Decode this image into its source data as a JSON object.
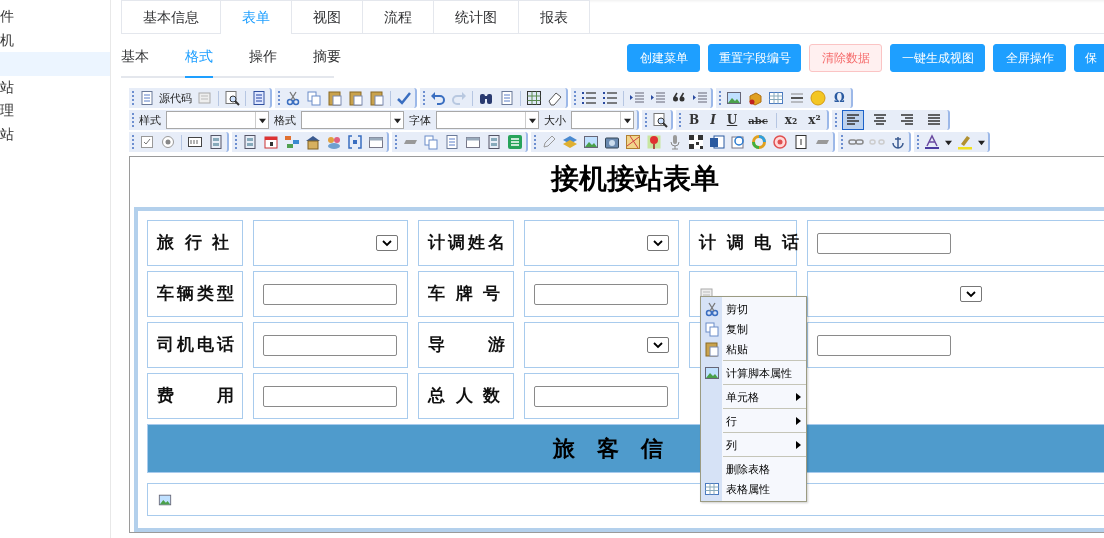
{
  "sidebar": {
    "items": [
      {
        "label": "件",
        "selected": false
      },
      {
        "label": "机",
        "selected": false
      },
      {
        "selected": true
      },
      {
        "label": "站",
        "selected": false
      },
      {
        "label": "理",
        "selected": false
      },
      {
        "label": "站",
        "selected": false
      }
    ]
  },
  "tabs": [
    {
      "label": "基本信息",
      "selected": false
    },
    {
      "label": "表单",
      "selected": true
    },
    {
      "label": "视图",
      "selected": false
    },
    {
      "label": "流程",
      "selected": false
    },
    {
      "label": "统计图",
      "selected": false
    },
    {
      "label": "报表",
      "selected": false
    }
  ],
  "subtabs": [
    {
      "label": "基本",
      "selected": false
    },
    {
      "label": "格式",
      "selected": true
    },
    {
      "label": "操作",
      "selected": false
    },
    {
      "label": "摘要",
      "selected": false
    }
  ],
  "actions": [
    {
      "label": "创建菜单",
      "kind": "primary"
    },
    {
      "label": "重置字段编号",
      "kind": "primary"
    },
    {
      "label": "清除数据",
      "kind": "danger"
    },
    {
      "label": "一键生成视图",
      "kind": "primary"
    },
    {
      "label": "全屏操作",
      "kind": "primary"
    },
    {
      "label": "保",
      "kind": "primary"
    }
  ],
  "editor": {
    "toolbar": {
      "source_label": "源代码",
      "special_char": "Ω",
      "fields": [
        {
          "label": "样式"
        },
        {
          "label": "格式"
        },
        {
          "label": "字体"
        },
        {
          "label": "大小"
        }
      ],
      "format_buttons": [
        "B",
        "I",
        "U",
        "abc",
        "x₂",
        "x²"
      ],
      "align_buttons": [
        {
          "selected": true
        },
        {
          "selected": false
        },
        {
          "selected": false
        },
        {
          "selected": false
        }
      ]
    },
    "document": {
      "title": "接机接站表单",
      "rows": [
        [
          {
            "kind": "label",
            "text": "旅 行 社"
          },
          {
            "kind": "select"
          },
          {
            "kind": "label",
            "text": "计调姓名"
          },
          {
            "kind": "select"
          },
          {
            "kind": "label",
            "text": "计 调 电 话"
          },
          {
            "kind": "text"
          }
        ],
        [
          {
            "kind": "label",
            "text": "车辆类型"
          },
          {
            "kind": "text"
          },
          {
            "kind": "label",
            "text": "车 牌 号"
          },
          {
            "kind": "text"
          },
          {
            "kind": "icon"
          },
          {
            "kind": "select"
          }
        ],
        [
          {
            "kind": "label",
            "text": "司机电话"
          },
          {
            "kind": "text"
          },
          {
            "kind": "label",
            "text": "导　　游"
          },
          {
            "kind": "select"
          },
          {
            "kind": "empty"
          },
          {
            "kind": "text"
          }
        ],
        [
          {
            "kind": "label",
            "text": "费　　用"
          },
          {
            "kind": "text"
          },
          {
            "kind": "label",
            "text": "总 人 数"
          },
          {
            "kind": "text"
          }
        ]
      ],
      "section_bar": "旅　客　信"
    }
  },
  "context_menu": {
    "items": [
      {
        "kind": "item",
        "label": "剪切"
      },
      {
        "kind": "item",
        "label": "复制"
      },
      {
        "kind": "item",
        "label": "粘贴"
      },
      {
        "kind": "separator"
      },
      {
        "kind": "item",
        "label": "计算脚本属性"
      },
      {
        "kind": "separator"
      },
      {
        "kind": "submenu",
        "label": "单元格"
      },
      {
        "kind": "separator"
      },
      {
        "kind": "submenu",
        "label": "行"
      },
      {
        "kind": "separator"
      },
      {
        "kind": "submenu",
        "label": "列"
      },
      {
        "kind": "separator"
      },
      {
        "kind": "item",
        "label": "删除表格"
      },
      {
        "kind": "item",
        "label": "表格属性"
      }
    ]
  }
}
